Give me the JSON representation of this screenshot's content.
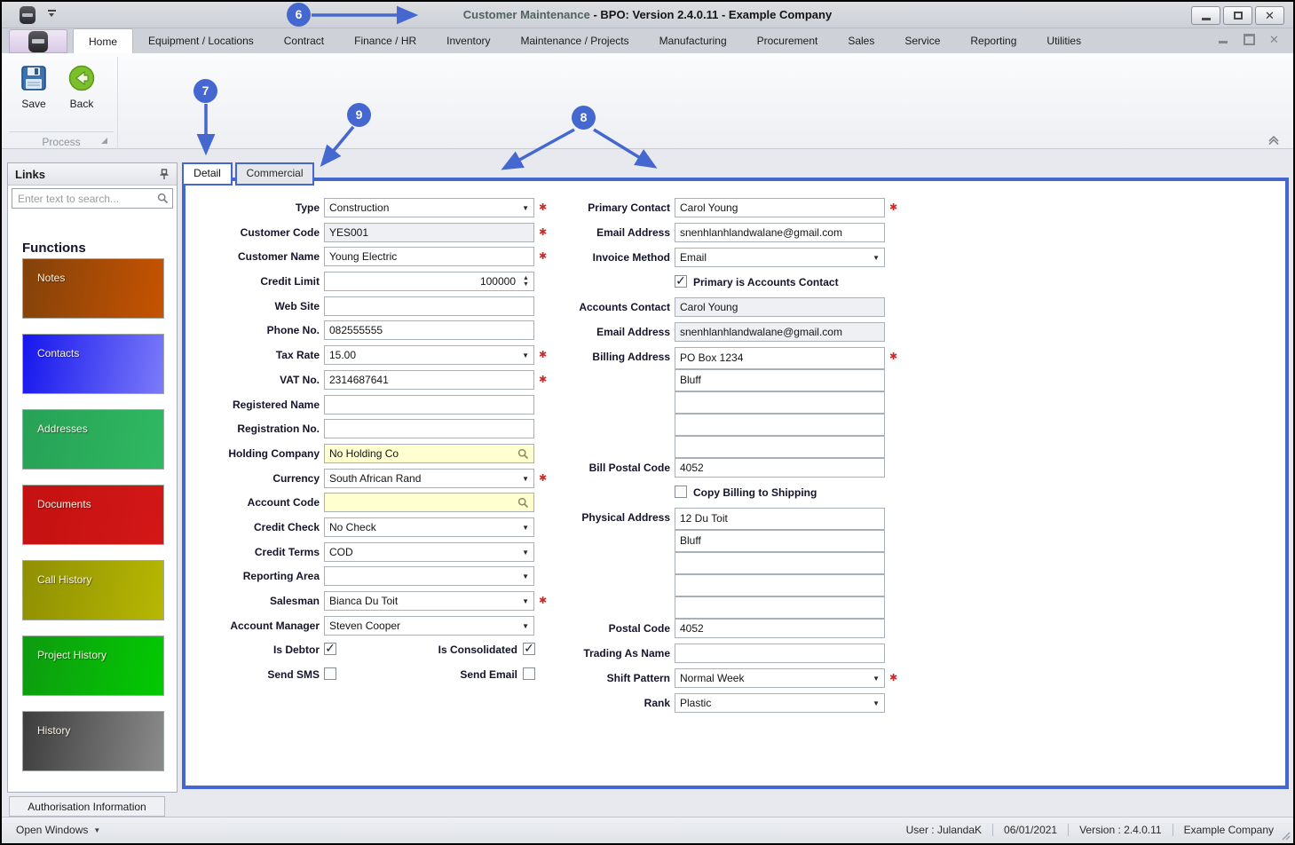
{
  "window": {
    "title_highlight": "Customer Maintenance",
    "title_rest": " - BPO: Version 2.4.0.11 - Example Company"
  },
  "menu": {
    "tabs": [
      "Home",
      "Equipment / Locations",
      "Contract",
      "Finance / HR",
      "Inventory",
      "Maintenance / Projects",
      "Manufacturing",
      "Procurement",
      "Sales",
      "Service",
      "Reporting",
      "Utilities"
    ],
    "active_index": 0
  },
  "ribbon": {
    "save_label": "Save",
    "back_label": "Back",
    "group_label": "Process"
  },
  "links": {
    "title": "Links",
    "search_placeholder": "Enter text to search...",
    "functions_heading": "Functions",
    "tiles": [
      {
        "label": "Notes",
        "from": "#83420a",
        "to": "#c75301"
      },
      {
        "label": "Contacts",
        "from": "#1616ee",
        "to": "#7b7bf9"
      },
      {
        "label": "Addresses",
        "from": "#27a156",
        "to": "#2fb961"
      },
      {
        "label": "Documents",
        "from": "#c41111",
        "to": "#d31717"
      },
      {
        "label": "Call History",
        "from": "#8f8f03",
        "to": "#b7b703"
      },
      {
        "label": "Project History",
        "from": "#0e9b10",
        "to": "#03ca02"
      },
      {
        "label": "History",
        "from": "#3d3d3d",
        "to": "#8b8b8b"
      }
    ]
  },
  "tabs": {
    "detail": "Detail",
    "commercial": "Commercial"
  },
  "form": {
    "required_marker": "✱",
    "left": [
      {
        "kind": "field",
        "label": "Type",
        "value": "Construction",
        "type": "combo",
        "required": true
      },
      {
        "kind": "field",
        "label": "Customer Code",
        "value": "YES001",
        "type": "readonly",
        "required": true
      },
      {
        "kind": "field",
        "label": "Customer Name",
        "value": "Young Electric",
        "type": "text",
        "required": true
      },
      {
        "kind": "field",
        "label": "Credit Limit",
        "value": "100000",
        "type": "spin"
      },
      {
        "kind": "field",
        "label": "Web Site",
        "value": "",
        "type": "text"
      },
      {
        "kind": "field",
        "label": "Phone No.",
        "value": "082555555",
        "type": "text"
      },
      {
        "kind": "field",
        "label": "Tax Rate",
        "value": "15.00",
        "type": "combo",
        "required": true
      },
      {
        "kind": "field",
        "label": "VAT No.",
        "value": "2314687641",
        "type": "text",
        "required": true
      },
      {
        "kind": "field",
        "label": "Registered Name",
        "value": "",
        "type": "text"
      },
      {
        "kind": "field",
        "label": "Registration No.",
        "value": "",
        "type": "text"
      },
      {
        "kind": "field",
        "label": "Holding Company",
        "value": "No Holding Co",
        "type": "lookup"
      },
      {
        "kind": "field",
        "label": "Currency",
        "value": "South African Rand",
        "type": "combo",
        "required": true
      },
      {
        "kind": "field",
        "label": "Account Code",
        "value": "",
        "type": "lookup"
      },
      {
        "kind": "field",
        "label": "Credit Check",
        "value": "No Check",
        "type": "combo"
      },
      {
        "kind": "field",
        "label": "Credit Terms",
        "value": "COD",
        "type": "combo"
      },
      {
        "kind": "field",
        "label": "Reporting Area",
        "value": "",
        "type": "combo"
      },
      {
        "kind": "field",
        "label": "Salesman",
        "value": "Bianca Du Toit",
        "type": "combo",
        "required": true
      },
      {
        "kind": "field",
        "label": "Account Manager",
        "value": "Steven Cooper",
        "type": "combo"
      },
      {
        "kind": "dual-checkbox",
        "a_label": "Is Debtor",
        "a_checked": true,
        "b_label": "Is Consolidated",
        "b_checked": true
      },
      {
        "kind": "dual-checkbox",
        "a_label": "Send SMS",
        "a_checked": false,
        "b_label": "Send Email",
        "b_checked": false
      }
    ],
    "right": [
      {
        "kind": "field",
        "label": "Primary Contact",
        "value": "Carol Young",
        "type": "text",
        "required": true
      },
      {
        "kind": "field",
        "label": "Email Address",
        "value": "snenhlanhlandwalane@gmail.com",
        "type": "text"
      },
      {
        "kind": "field",
        "label": "Invoice Method",
        "value": "Email",
        "type": "combo"
      },
      {
        "kind": "checkbox",
        "label": "Primary is Accounts Contact",
        "checked": true
      },
      {
        "kind": "field",
        "label": "Accounts Contact",
        "value": "Carol Young",
        "type": "readonly"
      },
      {
        "kind": "field",
        "label": "Email Address",
        "value": "snenhlanhlandwalane@gmail.com",
        "type": "readonly"
      },
      {
        "kind": "field",
        "label": "Billing Address",
        "value": "PO Box 1234",
        "type": "text",
        "required": true,
        "stack": "start"
      },
      {
        "kind": "field",
        "label": "",
        "value": "Bluff",
        "type": "text",
        "stack": "mid"
      },
      {
        "kind": "field",
        "label": "",
        "value": "",
        "type": "text",
        "stack": "mid"
      },
      {
        "kind": "field",
        "label": "",
        "value": "",
        "type": "text",
        "stack": "mid"
      },
      {
        "kind": "field",
        "label": "",
        "value": "",
        "type": "text",
        "stack": "mid"
      },
      {
        "kind": "field",
        "label": "Bill Postal Code",
        "value": "4052",
        "type": "text",
        "stack": "end"
      },
      {
        "kind": "checkbox",
        "label": "Copy Billing to Shipping",
        "checked": false
      },
      {
        "kind": "field",
        "label": "Physical Address",
        "value": "12 Du Toit",
        "type": "text",
        "stack": "start"
      },
      {
        "kind": "field",
        "label": "",
        "value": "Bluff",
        "type": "text",
        "stack": "mid"
      },
      {
        "kind": "field",
        "label": "",
        "value": "",
        "type": "text",
        "stack": "mid"
      },
      {
        "kind": "field",
        "label": "",
        "value": "",
        "type": "text",
        "stack": "mid"
      },
      {
        "kind": "field",
        "label": "",
        "value": "",
        "type": "text",
        "stack": "mid"
      },
      {
        "kind": "field",
        "label": "Postal Code",
        "value": "4052",
        "type": "text",
        "stack": "end"
      },
      {
        "kind": "field",
        "label": "Trading As Name",
        "value": "",
        "type": "text"
      },
      {
        "kind": "field",
        "label": "Shift Pattern",
        "value": "Normal Week",
        "type": "combo",
        "required": true
      },
      {
        "kind": "field",
        "label": "Rank",
        "value": "Plastic",
        "type": "combo"
      }
    ]
  },
  "footer": {
    "auth_tab": "Authorisation Information",
    "open_windows": "Open Windows",
    "user": "User : JulandaK",
    "date": "06/01/2021",
    "version": "Version : 2.4.0.11",
    "company": "Example Company"
  },
  "callouts": {
    "c6": "6",
    "c7": "7",
    "c8": "8",
    "c9": "9"
  },
  "accents": {
    "callout_blue": "#4468cf",
    "required_red": "#cc2a2a",
    "lookup_yellow": "#ffffcf"
  }
}
